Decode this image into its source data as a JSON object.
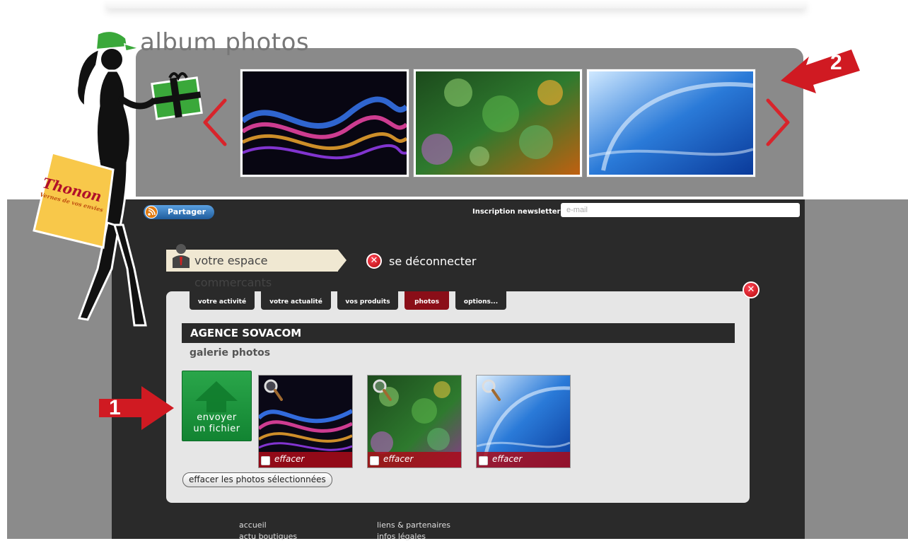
{
  "header": {
    "title": "album photos"
  },
  "share": {
    "label": "Partager"
  },
  "newsletter": {
    "label": "Inscription newsletter :",
    "placeholder": "e-mail"
  },
  "account": {
    "espace_label": "votre espace commercants",
    "logout_label": "se déconnecter"
  },
  "tabs": [
    {
      "label": "votre activité",
      "active": false
    },
    {
      "label": "votre actualité",
      "active": false
    },
    {
      "label": "vos produits",
      "active": false
    },
    {
      "label": "photos",
      "active": true
    },
    {
      "label": "options...",
      "active": false
    }
  ],
  "panel": {
    "company": "AGENCE SOVACOM",
    "gallery_title": "galerie photos",
    "upload_label_1": "envoyer",
    "upload_label_2": "un fichier",
    "photos": [
      {
        "delete_label": "effacer"
      },
      {
        "delete_label": "effacer"
      },
      {
        "delete_label": "effacer"
      }
    ],
    "delete_selected_label": "effacer les photos sélectionnées"
  },
  "footer": {
    "col1": [
      "accueil",
      "actu boutiques"
    ],
    "col2": [
      "liens & partenaires",
      "infos légales"
    ]
  },
  "callouts": [
    "1",
    "2"
  ],
  "logo_text": "Thonon Vernes de vos envies",
  "colors": {
    "accent_red": "#d8242b",
    "tab_active": "#8a0e18",
    "upload_green": "#1a9a3c",
    "panel_bg": "#e6e6e6",
    "dark_bg": "#2a2a2a"
  }
}
